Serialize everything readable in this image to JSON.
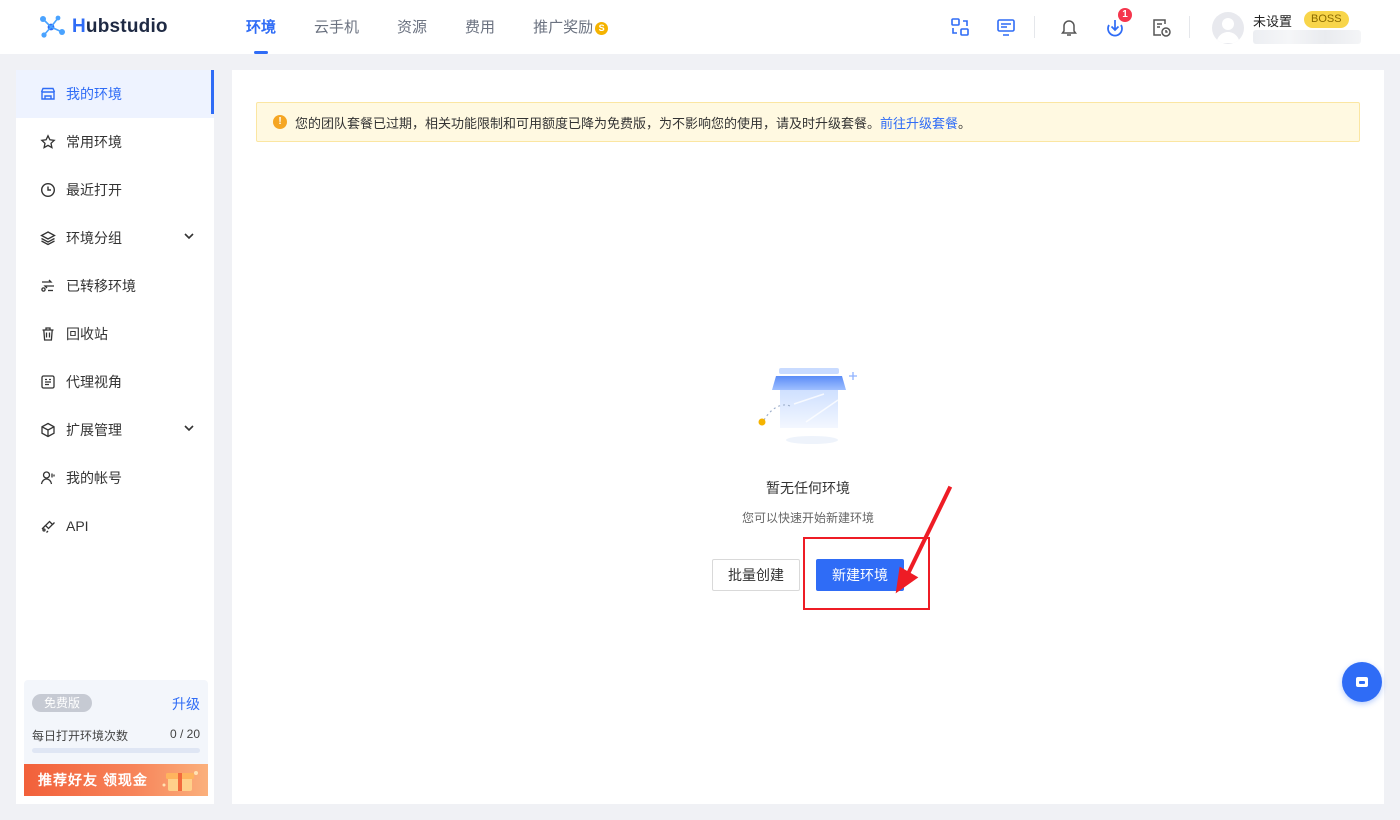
{
  "app": {
    "logo_text_h": "H",
    "logo_text_rest": "ubstudio"
  },
  "nav": {
    "items": [
      "环境",
      "云手机",
      "资源",
      "费用",
      "推广奖励"
    ],
    "promo_coin": "S"
  },
  "toolbar": {
    "download_badge": "1"
  },
  "user": {
    "name": "未设置",
    "role": "BOSS"
  },
  "sidebar": {
    "items": [
      {
        "label": "我的环境",
        "icon": "store-icon"
      },
      {
        "label": "常用环境",
        "icon": "star-icon"
      },
      {
        "label": "最近打开",
        "icon": "clock-icon"
      },
      {
        "label": "环境分组",
        "icon": "layers-icon"
      },
      {
        "label": "已转移环境",
        "icon": "transfer-icon"
      },
      {
        "label": "回收站",
        "icon": "trash-icon"
      },
      {
        "label": "代理视角",
        "icon": "proxy-icon"
      },
      {
        "label": "扩展管理",
        "icon": "cube-icon"
      },
      {
        "label": "我的帐号",
        "icon": "user-icon"
      },
      {
        "label": "API",
        "icon": "api-icon"
      }
    ],
    "plan": {
      "tag": "免费版",
      "upgrade": "升级",
      "usage_label": "每日打开环境次数",
      "usage_count": "0 / 20",
      "usage_fraction": 0
    },
    "promo": "推荐好友 领现金"
  },
  "notice": {
    "icon": "!",
    "text": "您的团队套餐已过期，相关功能限制和可用额度已降为免费版，为不影响您的使用，请及时升级套餐。",
    "link": "前往升级套餐",
    "suffix": "。"
  },
  "empty": {
    "title": "暂无任何环境",
    "subtitle": "您可以快速开始新建环境"
  },
  "buttons": {
    "batch": "批量创建",
    "new": "新建环境"
  },
  "colors": {
    "primary": "#2f6cf6",
    "annotation": "#ee1c25"
  }
}
